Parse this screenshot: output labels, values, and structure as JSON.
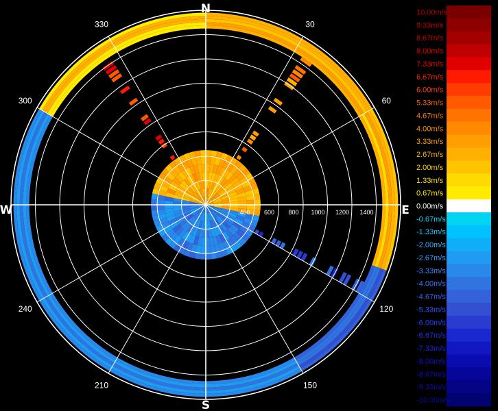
{
  "chart_data": {
    "type": "polar-ppi",
    "cardinals": {
      "n": "N",
      "e": "E",
      "s": "S",
      "w": "W"
    },
    "azimuth_labels": [
      {
        "deg": 30,
        "text": "30"
      },
      {
        "deg": 60,
        "text": "60"
      },
      {
        "deg": 120,
        "text": "120"
      },
      {
        "deg": 150,
        "text": "150"
      },
      {
        "deg": 210,
        "text": "210"
      },
      {
        "deg": 240,
        "text": "240"
      },
      {
        "deg": 300,
        "text": "300"
      },
      {
        "deg": 330,
        "text": "330"
      }
    ],
    "range_rings": [
      200,
      400,
      600,
      800,
      1000,
      1200,
      1400
    ],
    "range_labels": [
      {
        "value": 400,
        "text": "400"
      },
      {
        "value": 600,
        "text": "600"
      },
      {
        "value": 800,
        "text": "800"
      },
      {
        "value": 1000,
        "text": "1000"
      },
      {
        "value": 1200,
        "text": "1200"
      },
      {
        "value": 1400,
        "text": "1400"
      }
    ],
    "max_range": 1600,
    "velocity_unit": "m/s",
    "velocity_range": [
      -10,
      10
    ],
    "inner_field": {
      "max_range": 450,
      "approach_azimuth_from": 100,
      "approach_azimuth_to": 280
    },
    "outer_band": {
      "range_from": 1450,
      "range_to": 1580
    },
    "velocity_bands": [
      {
        "az_from": 0,
        "az_to": 60,
        "velocity": 3.0
      },
      {
        "az_from": 60,
        "az_to": 110,
        "velocity": 2.5
      },
      {
        "az_from": 110,
        "az_to": 150,
        "velocity": -4.5
      },
      {
        "az_from": 150,
        "az_to": 300,
        "velocity": -3.0
      },
      {
        "az_from": 300,
        "az_to": 360,
        "velocity": 1.5
      }
    ],
    "radials": [
      {
        "az": 325,
        "velocity": 6.5
      },
      {
        "az": 118,
        "velocity": -5.5
      },
      {
        "az": 35,
        "velocity": 4.0
      }
    ],
    "legend": {
      "colors": [
        "#7a0000",
        "#8c0000",
        "#a30000",
        "#c00000",
        "#e00000",
        "#ff1a00",
        "#ff3c00",
        "#ff5a00",
        "#ff7400",
        "#ff8a00",
        "#ff9e00",
        "#ffb000",
        "#ffc400",
        "#ffda00",
        "#ffea00",
        "#ffffff",
        "#00d4f0",
        "#00c2ff",
        "#10aef8",
        "#1f9cf2",
        "#2a88ea",
        "#3074e2",
        "#3462da",
        "#3450d2",
        "#2a3cd0",
        "#1a28d0",
        "#1018c2",
        "#0a0cb0",
        "#06069a",
        "#040484",
        "#020270"
      ],
      "text_colors": [
        "#b40000",
        "#bf0000",
        "#cc0000",
        "#dd0000",
        "#ee0000",
        "#ff2000",
        "#ff4000",
        "#ff6000",
        "#ff7a00",
        "#ff9000",
        "#ffa400",
        "#ffb800",
        "#ffcc00",
        "#ffe000",
        "#ffee00",
        "#ffffff",
        "#00d8ff",
        "#22c4ff",
        "#33b0ff",
        "#3a9cff",
        "#3a88ff",
        "#3a74ff",
        "#3462ff",
        "#2a50ff",
        "#2040ff",
        "#1a30f0",
        "#1420e0",
        "#1010d0",
        "#0c0cc0",
        "#0a0ab0",
        "#0808a0"
      ],
      "labels": [
        "10.00m/s",
        "9.33m/s",
        "8.67m/s",
        "8.00m/s",
        "7.33m/s",
        "6.67m/s",
        "6.00m/s",
        "5.33m/s",
        "4.67m/s",
        "4.00m/s",
        "3.33m/s",
        "2.67m/s",
        "2.00m/s",
        "1.33m/s",
        "0.67m/s",
        "0.00m/s",
        "-0.67m/s",
        "-1.33m/s",
        "-2.00m/s",
        "-2.67m/s",
        "-3.33m/s",
        "-4.00m/s",
        "-4.67m/s",
        "-5.33m/s",
        "-6.00m/s",
        "-6.67m/s",
        "-7.33m/s",
        "-8.00m/s",
        "-8.67m/s",
        "-9.33m/s",
        "-10.00m/s"
      ]
    }
  }
}
